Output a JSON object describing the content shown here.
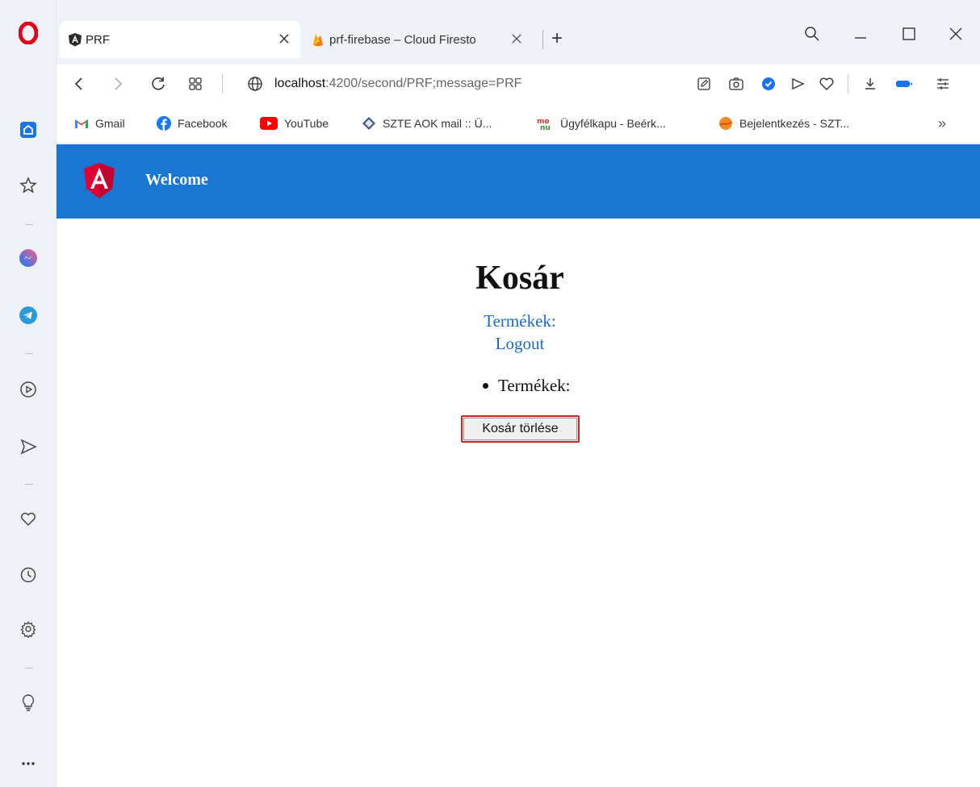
{
  "browser": {
    "tabs": [
      {
        "title": "PRF",
        "active": true
      },
      {
        "title": "prf-firebase – Cloud Firesto",
        "active": false
      }
    ],
    "new_tab_label": "+",
    "url_host": "localhost",
    "url_path": ":4200/second/PRF;message=PRF",
    "bookmarks": [
      {
        "label": "Gmail",
        "icon": "gmail-icon"
      },
      {
        "label": "Facebook",
        "icon": "facebook-icon"
      },
      {
        "label": "YouTube",
        "icon": "youtube-icon"
      },
      {
        "label": "SZTE AOK mail :: Ü...",
        "icon": "mail-icon"
      },
      {
        "label": "Ügyfélkapu - Beérk...",
        "icon": "ugyfelkapu-icon"
      },
      {
        "label": "Bejelentkezés - SZT...",
        "icon": "orange-ball-icon"
      }
    ],
    "more_bookmarks": "»"
  },
  "app": {
    "toolbar_title": "Welcome",
    "heading": "Kosár",
    "nav_links": [
      "Termékek:",
      "Logout"
    ],
    "list_items": [
      "Termékek:"
    ],
    "clear_button": "Kosár törlése"
  },
  "colors": {
    "app_bar": "#1976d2",
    "link": "#1b6ad0",
    "button_focus_border": "#c62828",
    "opera_red": "#e0001b"
  }
}
